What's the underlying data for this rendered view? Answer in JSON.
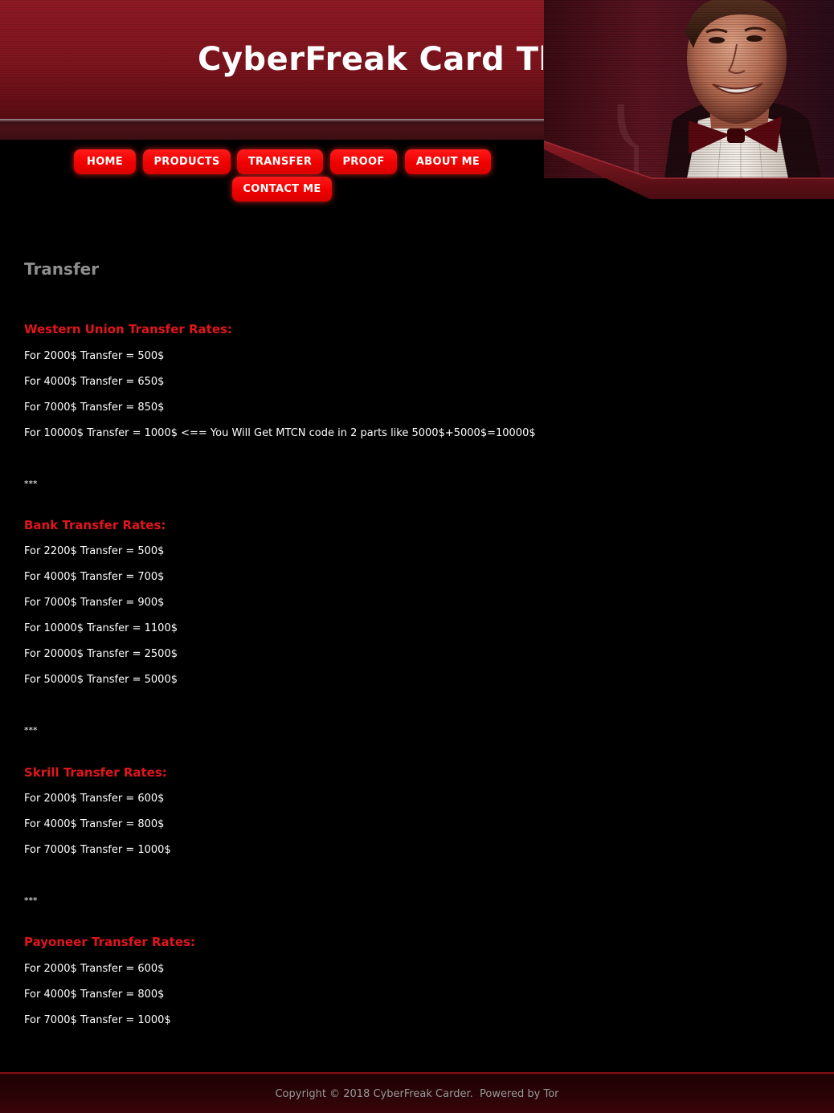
{
  "site": {
    "title": "CyberFreak Card The"
  },
  "nav": {
    "items": [
      {
        "label": "HOME"
      },
      {
        "label": "PRODUCTS"
      },
      {
        "label": "TRANSFER"
      },
      {
        "label": "PROOF"
      },
      {
        "label": "ABOUT ME"
      },
      {
        "label": "CONTACT ME"
      }
    ]
  },
  "page": {
    "title": "Transfer"
  },
  "sections": [
    {
      "heading": "Western Union Transfer Rates:",
      "lines": [
        "For 2000$ Transfer = 500$",
        "For 4000$ Transfer = 650$",
        "For 7000$ Transfer = 850$",
        "For 10000$ Transfer = 1000$ <== You Will Get MTCN code in 2 parts like 5000$+5000$=10000$"
      ],
      "separator": "***"
    },
    {
      "heading": "Bank Transfer Rates:",
      "lines": [
        "For 2200$ Transfer = 500$",
        "For 4000$ Transfer = 700$",
        "For 7000$ Transfer = 900$",
        "For 10000$ Transfer = 1100$",
        "For 20000$ Transfer = 2500$",
        "For 50000$ Transfer = 5000$"
      ],
      "separator": "***"
    },
    {
      "heading": "Skrill Transfer Rates:",
      "lines": [
        "For 2000$ Transfer = 600$",
        "For 4000$ Transfer = 800$",
        "For 7000$ Transfer = 1000$"
      ],
      "separator": "***"
    },
    {
      "heading": "Payoneer Transfer Rates:",
      "lines": [
        "For 2000$ Transfer = 600$",
        "For 4000$ Transfer = 800$",
        "For 7000$ Transfer = 1000$"
      ]
    }
  ],
  "footer": {
    "copyright": "Copyright © 2018 CyberFreak Carder.",
    "powered": "Powered by Tor"
  },
  "colors": {
    "accent_red": "#e0161c",
    "button_red": "#f00000",
    "header_red": "#8e1a24",
    "background": "#000000",
    "title_gray": "#8e8e8e"
  },
  "icons": {
    "portrait": "man-in-tuxedo-portrait"
  }
}
